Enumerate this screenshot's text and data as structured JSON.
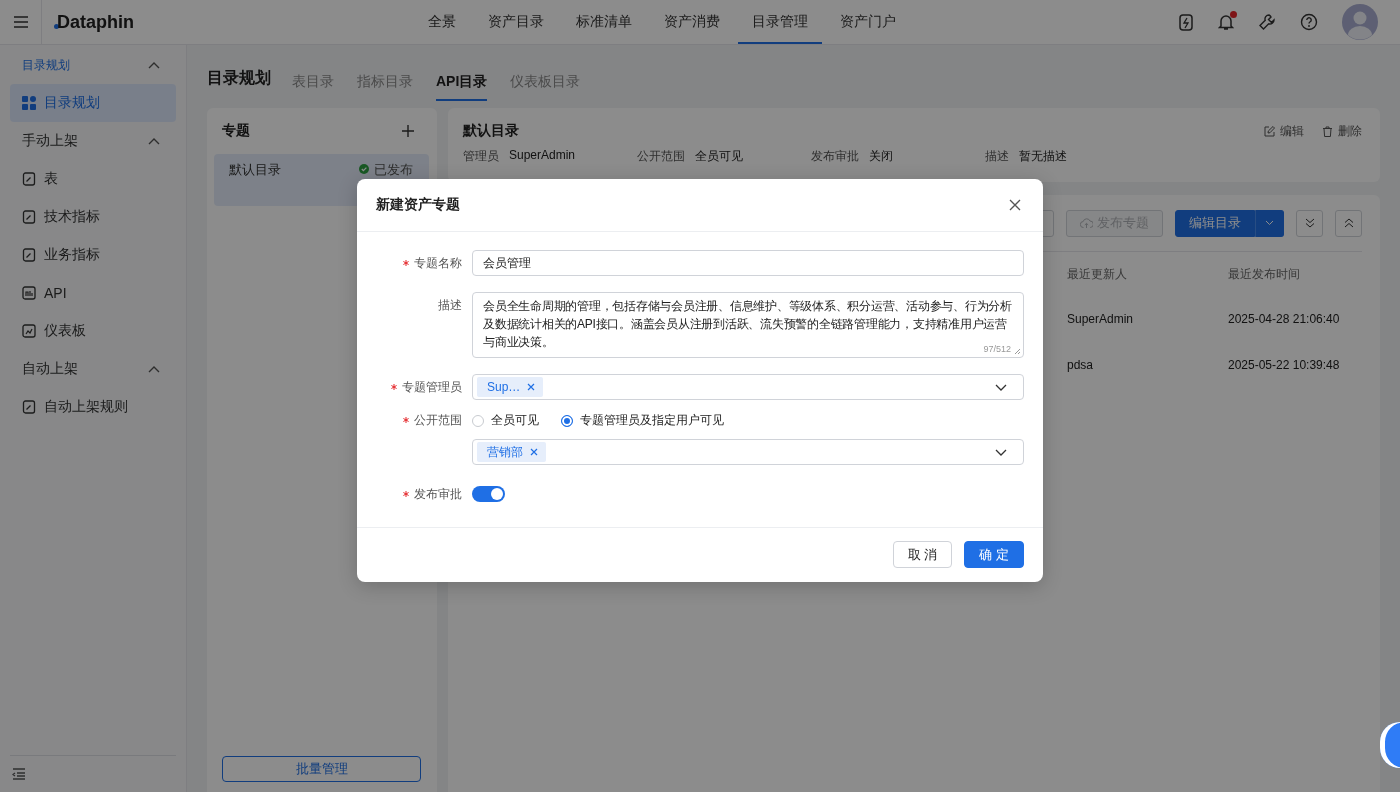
{
  "header": {
    "brand": "Dataphin",
    "nav": [
      {
        "label": "全景",
        "selected": false
      },
      {
        "label": "资产目录",
        "selected": false
      },
      {
        "label": "标准清单",
        "selected": false
      },
      {
        "label": "资产消费",
        "selected": false
      },
      {
        "label": "目录管理",
        "selected": true
      },
      {
        "label": "资产门户",
        "selected": false
      }
    ],
    "notification_unread": true
  },
  "sidebar": {
    "groups": [
      {
        "title": "目录规划",
        "expanded": true,
        "items": [
          {
            "label": "目录规划",
            "selected": true
          }
        ]
      },
      {
        "title": "手动上架",
        "expanded": true,
        "items": [
          {
            "label": "表",
            "selected": false
          },
          {
            "label": "技术指标",
            "selected": false
          },
          {
            "label": "业务指标",
            "selected": false
          },
          {
            "label": "API",
            "selected": false
          },
          {
            "label": "仪表板",
            "selected": false
          }
        ]
      },
      {
        "title": "自动上架",
        "expanded": true,
        "items": [
          {
            "label": "自动上架规则",
            "selected": false
          }
        ]
      }
    ]
  },
  "page": {
    "title": "目录规划",
    "tabs": [
      {
        "label": "表目录",
        "selected": false
      },
      {
        "label": "指标目录",
        "selected": false
      },
      {
        "label": "API目录",
        "selected": true
      },
      {
        "label": "仪表板目录",
        "selected": false
      }
    ]
  },
  "topics": {
    "title": "专题",
    "items": [
      {
        "name": "默认目录",
        "status": "已发布",
        "selected": true
      }
    ],
    "batch_button": "批量管理"
  },
  "detail": {
    "title": "默认目录",
    "actions": [
      "编辑",
      "删除"
    ],
    "fields": [
      {
        "label": "管理员",
        "value": "SuperAdmin"
      },
      {
        "label": "公开范围",
        "value": "全员可见"
      },
      {
        "label": "发布审批",
        "value": "关闭"
      },
      {
        "label": "描述",
        "value": "暂无描述"
      }
    ]
  },
  "toolbar": {
    "publish": {
      "label": "发布专题",
      "disabled": true
    },
    "edit": {
      "label": "编辑目录",
      "disabled": false
    }
  },
  "table": {
    "columns": [
      "最近更新人",
      "最近发布时间"
    ],
    "rows": [
      [
        "SuperAdmin",
        "2025-04-28 21:06:40"
      ],
      [
        "pdsa",
        "2025-05-22 10:39:48"
      ]
    ]
  },
  "dialog": {
    "title": "新建资产专题",
    "name": {
      "label": "专题名称",
      "required": true,
      "value": "会员管理"
    },
    "description": {
      "label": "描述",
      "required": false,
      "value": "会员全生命周期的管理，包括存储与会员注册、信息维护、等级体系、积分运营、活动参与、行为分析及数据统计相关的API接口。涵盖会员从注册到活跃、流失预警的全链路管理能力，支持精准用户运营与商业决策。",
      "counter": "97/512"
    },
    "managers": {
      "label": "专题管理员",
      "required": true,
      "tags": [
        "Sup…"
      ]
    },
    "scope": {
      "label": "公开范围",
      "required": true,
      "options": [
        {
          "label": "全员可见",
          "selected": false
        },
        {
          "label": "专题管理员及指定用户可见",
          "selected": true
        }
      ],
      "tags": [
        "营销部"
      ]
    },
    "approval": {
      "label": "发布审批",
      "required": true,
      "on": true
    },
    "buttons": {
      "cancel": "取 消",
      "ok": "确 定"
    }
  }
}
